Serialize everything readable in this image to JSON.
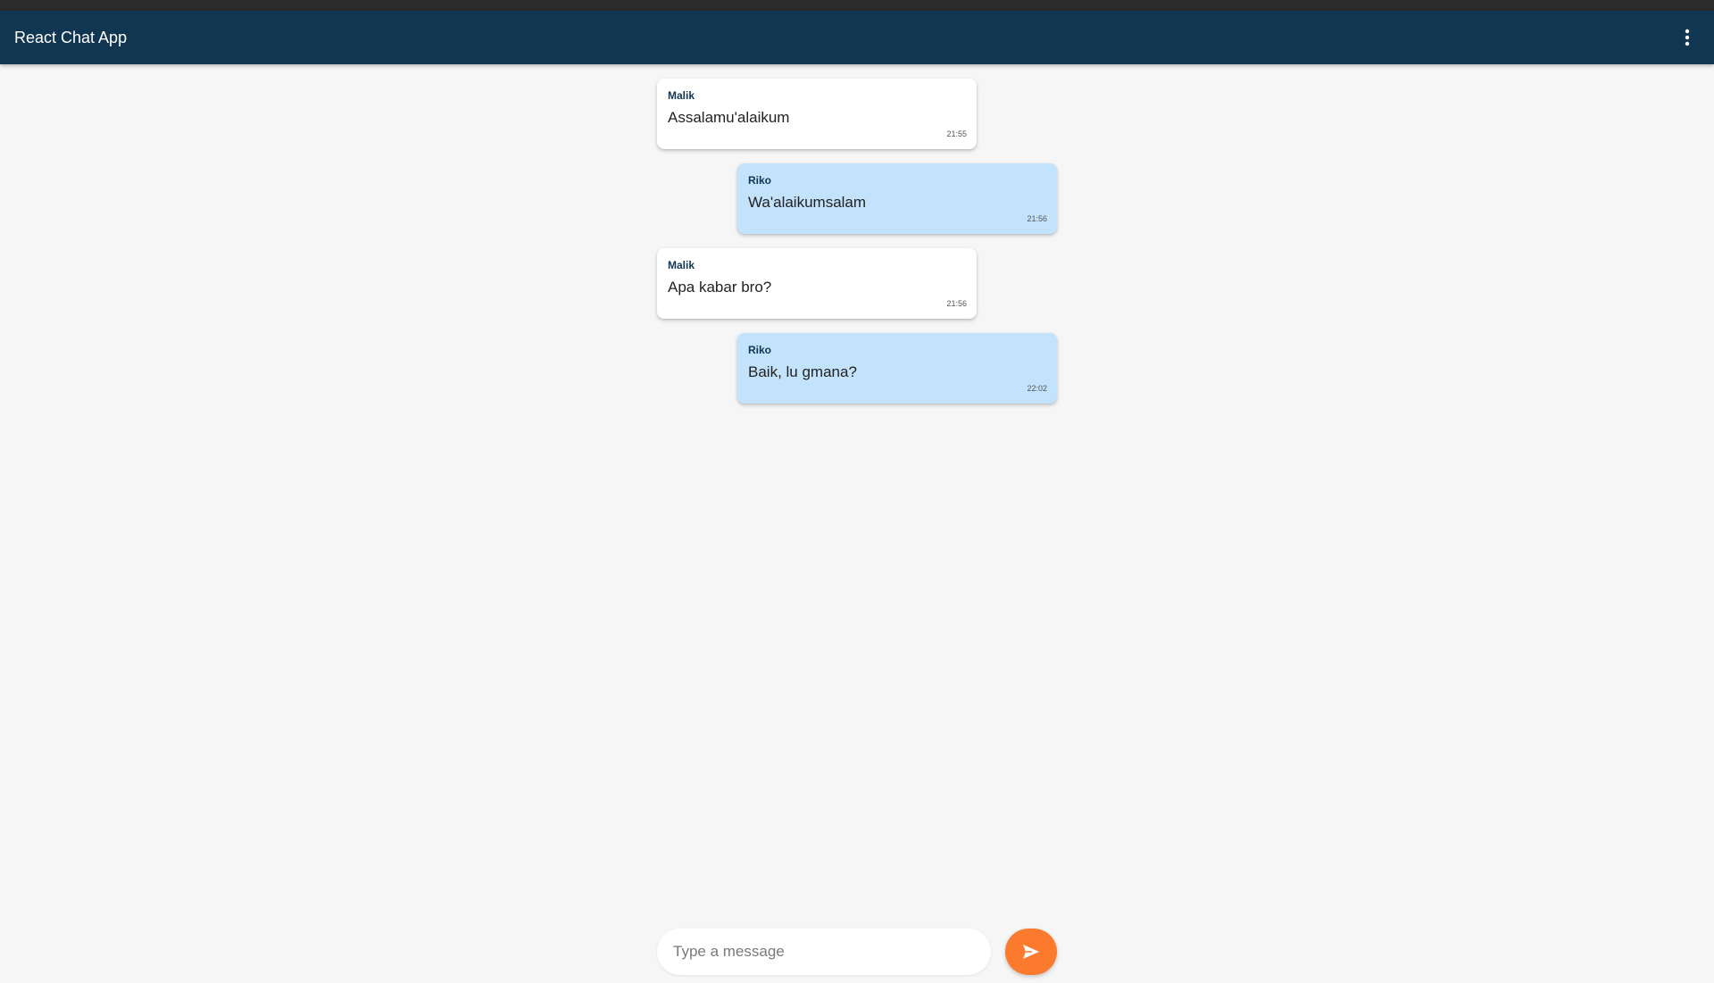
{
  "app": {
    "title": "React Chat App",
    "menu_icon": "more-vertical-icon",
    "colors": {
      "app_bar": "#113652",
      "incoming_bubble": "#ffffff",
      "outgoing_bubble": "#c2e3fb",
      "send_button": "#fb7a2e",
      "background": "#f6f6f6"
    }
  },
  "messages": [
    {
      "sender": "Malik",
      "text": "Assalamu'alaikum",
      "time": "21:55",
      "side": "left"
    },
    {
      "sender": "Riko",
      "text": "Wa'alaikumsalam",
      "time": "21:56",
      "side": "right"
    },
    {
      "sender": "Malik",
      "text": "Apa kabar bro?",
      "time": "21:56",
      "side": "left"
    },
    {
      "sender": "Riko",
      "text": "Baik, lu gmana?",
      "time": "22:02",
      "side": "right"
    }
  ],
  "composer": {
    "placeholder": "Type a message",
    "value": "",
    "send_icon": "send-icon"
  }
}
